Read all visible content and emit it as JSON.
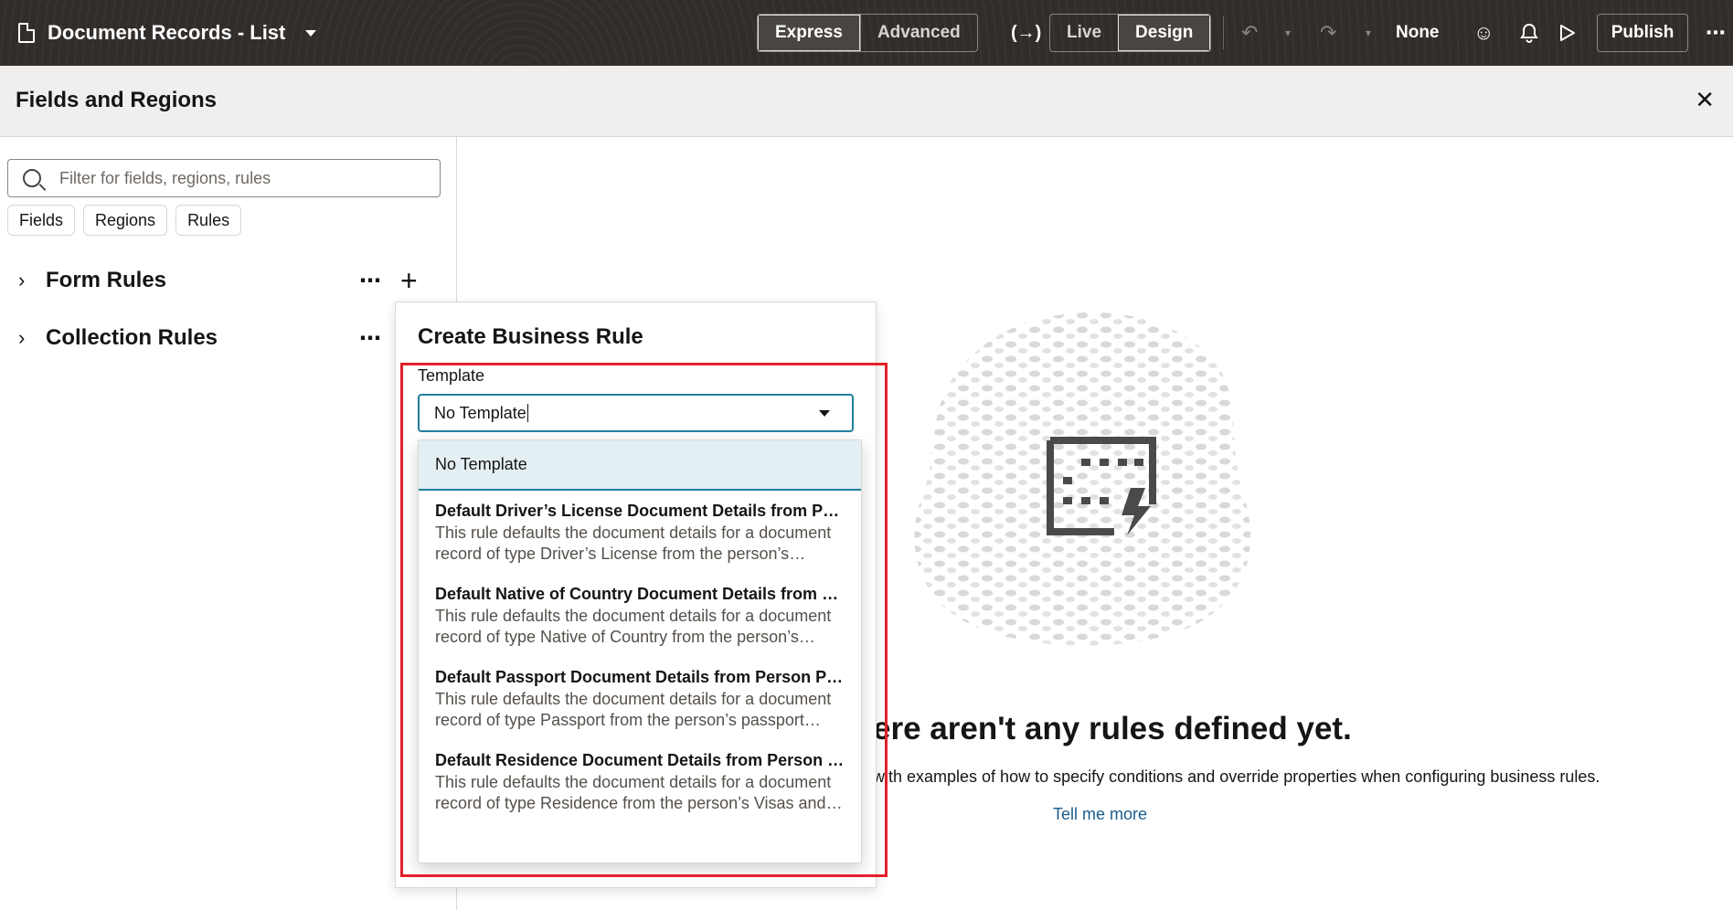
{
  "topbar": {
    "page_title": "Document Records - List",
    "mode_tabs": [
      "Express",
      "Advanced"
    ],
    "active_mode": "Express",
    "view_tabs": [
      "Live",
      "Design"
    ],
    "active_view": "Design",
    "sandbox_label": "None",
    "publish_label": "Publish"
  },
  "panel": {
    "title": "Fields and Regions",
    "search_placeholder": "Filter for fields, regions, rules",
    "chips": [
      "Fields",
      "Regions",
      "Rules"
    ],
    "rule_groups": [
      {
        "label": "Form Rules"
      },
      {
        "label": "Collection Rules"
      }
    ]
  },
  "empty_state": {
    "title": "ere aren't any rules defined yet.",
    "description": "with examples of how to specify conditions and override properties when configuring business rules.",
    "link": "Tell me more"
  },
  "create_rule": {
    "title": "Create Business Rule",
    "template_label": "Template",
    "template_value": "No Template",
    "options": [
      {
        "title": "No Template",
        "description": ""
      },
      {
        "title": "Default Driver’s License Document Details from Person Driver’s License",
        "description": "This rule defaults the document details for a document record of type Driver’s License from the person’s driver’s license details."
      },
      {
        "title": "Default Native of Country Document Details from Person Citizenship",
        "description": "This rule defaults the document details for a document record of type Native of Country from the person’s citizenship details."
      },
      {
        "title": "Default Passport Document Details from Person Passport",
        "description": "This rule defaults the document details for a document record of type Passport from the person’s passport details."
      },
      {
        "title": "Default Residence Document Details from Person Visas and Permits",
        "description": "This rule defaults the document details for a document record of type Residence from the person’s Visas and Permits details."
      }
    ]
  },
  "colors": {
    "topbar_bg": "#312d2a",
    "focus_border": "#227e9e",
    "selected_option_bg": "#e4eff3",
    "highlight_border": "#e3212a",
    "link": "#1b5d8c"
  }
}
